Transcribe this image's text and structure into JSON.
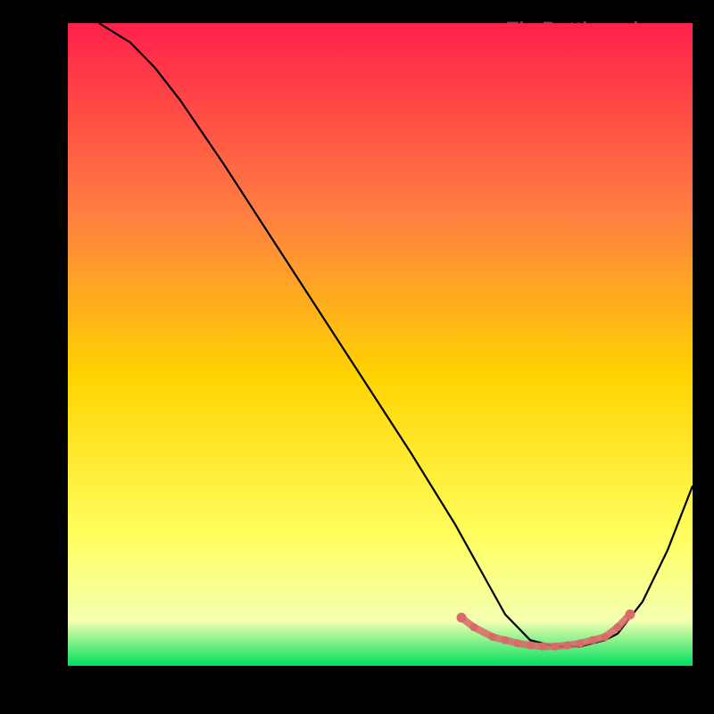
{
  "watermark": "TheBottleneck.com",
  "chart_data": {
    "type": "line",
    "title": "",
    "xlabel": "",
    "ylabel": "",
    "xlim": [
      0,
      100
    ],
    "ylim": [
      0,
      100
    ],
    "background_gradient": {
      "top": "#ff204a",
      "mid_upper": "#ff8040",
      "mid": "#ffd400",
      "mid_lower": "#ffff60",
      "bottom": "#00e060"
    },
    "series": [
      {
        "name": "bottleneck-curve",
        "color": "#000000",
        "x": [
          5,
          10,
          14,
          18,
          25,
          35,
          45,
          55,
          62,
          66,
          70,
          74,
          78,
          82,
          86,
          88,
          92,
          96,
          100
        ],
        "y": [
          100,
          97,
          93,
          88,
          78,
          63,
          48,
          33,
          22,
          15,
          8,
          4,
          3,
          3,
          4,
          5,
          10,
          18,
          28
        ]
      }
    ],
    "highlight_band": {
      "name": "optimal-range-dots",
      "color": "#d86a6a",
      "x": [
        63,
        65,
        68,
        70,
        72,
        74,
        76,
        78,
        80,
        82,
        84,
        86,
        88,
        90
      ],
      "y": [
        7.5,
        6.0,
        4.5,
        4.0,
        3.5,
        3.2,
        3.0,
        3.0,
        3.2,
        3.5,
        4.0,
        4.5,
        6.0,
        8.0
      ]
    }
  }
}
